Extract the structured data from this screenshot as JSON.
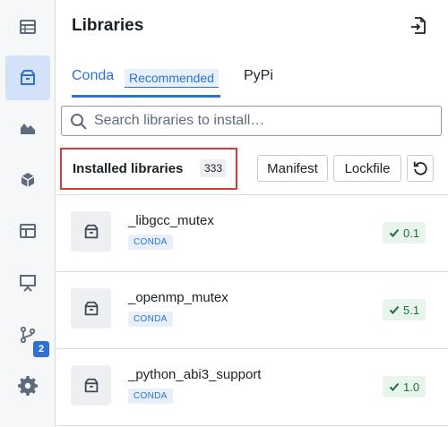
{
  "rail": {
    "items": [
      {
        "name": "table-icon",
        "active": false
      },
      {
        "name": "package-icon",
        "active": true
      },
      {
        "name": "area-chart-icon",
        "active": false
      },
      {
        "name": "cube-icon",
        "active": false
      },
      {
        "name": "layout-icon",
        "active": false
      },
      {
        "name": "presentation-icon",
        "active": false
      },
      {
        "name": "git-branch-icon",
        "active": false
      },
      {
        "name": "gear-icon",
        "active": false
      }
    ],
    "branch_badge": "2"
  },
  "header": {
    "title": "Libraries",
    "export_icon": "export-icon"
  },
  "tabs": {
    "conda": "Conda",
    "recommended": "Recommended",
    "pypi": "PyPi"
  },
  "search": {
    "placeholder": "Search libraries to install…"
  },
  "installed": {
    "label": "Installed libraries",
    "count": "333",
    "manifest_label": "Manifest",
    "lockfile_label": "Lockfile"
  },
  "libraries": [
    {
      "name": "_libgcc_mutex",
      "source": "CONDA",
      "version": "0.1"
    },
    {
      "name": "_openmp_mutex",
      "source": "CONDA",
      "version": "5.1"
    },
    {
      "name": "_python_abi3_support",
      "source": "CONDA",
      "version": "1.0"
    }
  ],
  "colors": {
    "accent": "#2d72d2",
    "highlight_box": "#d93b3b",
    "version_bg": "#e8f5ec",
    "version_fg": "#1c6e42"
  }
}
